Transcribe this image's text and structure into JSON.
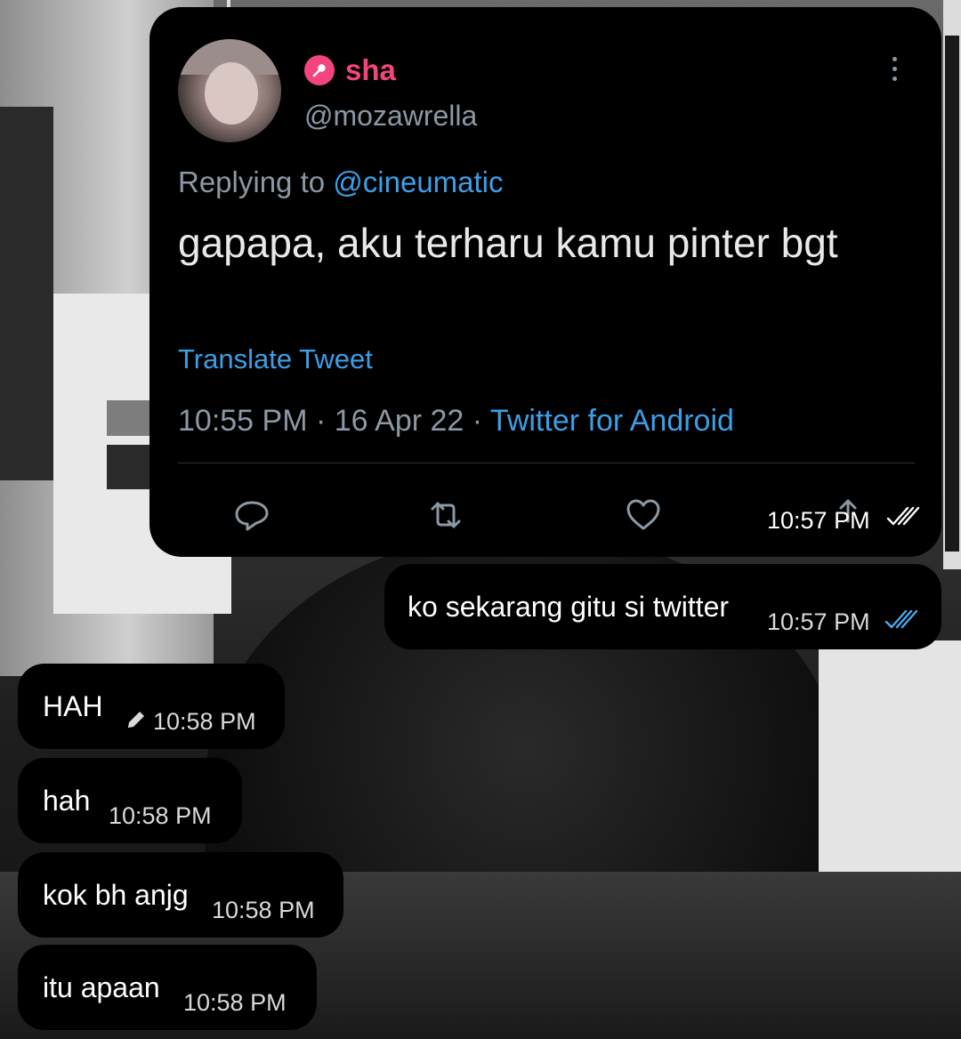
{
  "tweet": {
    "display_name": "sha",
    "username": "@mozawrella",
    "replying_prefix": "Replying to",
    "replying_handle": "@cineumatic",
    "text": "gapapa, aku terharu kamu pinter bgt",
    "translate_label": "Translate Tweet",
    "time": "10:55 PM",
    "separator": " · ",
    "date": "16 Apr 22",
    "source": "Twitter for Android",
    "icons": [
      "mic-icon",
      "more-icon",
      "reply-icon",
      "retweet-icon",
      "like-icon",
      "share-icon"
    ],
    "accent_color": "#f2457f",
    "link_color": "#3b9fe8"
  },
  "messages": [
    {
      "direction": "outgoing",
      "text": "",
      "time": "10:57 PM",
      "status": "read",
      "attachment": "tweet"
    },
    {
      "direction": "outgoing",
      "text": "ko sekarang gitu si twitter",
      "time": "10:57 PM",
      "status": "read"
    },
    {
      "direction": "incoming",
      "text": "HAH",
      "time": "10:58 PM",
      "edited": true
    },
    {
      "direction": "incoming",
      "text": "hah",
      "time": "10:58 PM"
    },
    {
      "direction": "incoming",
      "text": "kok bh anjg",
      "time": "10:58 PM"
    },
    {
      "direction": "incoming",
      "text": "itu apaan",
      "time": "10:58 PM"
    }
  ],
  "check_color": "#4aa8f0"
}
